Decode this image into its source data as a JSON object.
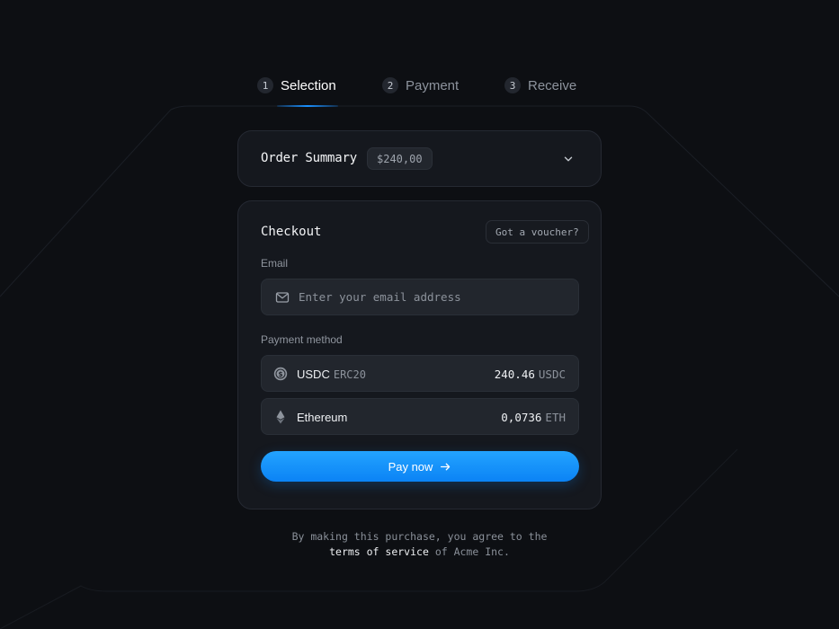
{
  "stepper": {
    "steps": [
      {
        "number": "1",
        "label": "Selection",
        "active": true
      },
      {
        "number": "2",
        "label": "Payment",
        "active": false
      },
      {
        "number": "3",
        "label": "Receive",
        "active": false
      }
    ]
  },
  "order_summary": {
    "title": "Order Summary",
    "amount": "$240,00",
    "toggle_icon": "chevron-down-icon"
  },
  "checkout": {
    "heading": "Checkout",
    "voucher_label": "Got a voucher?",
    "email": {
      "label": "Email",
      "placeholder": "Enter your email address",
      "value": "",
      "icon": "mail-icon"
    },
    "payment_method_label": "Payment method",
    "methods": [
      {
        "name": "USDC",
        "network": "ERC20",
        "amount": "240.46",
        "unit": "USDC",
        "icon": "usdc-icon"
      },
      {
        "name": "Ethereum",
        "network": "",
        "amount": "0,0736",
        "unit": "ETH",
        "icon": "ethereum-icon"
      }
    ],
    "pay_button_label": "Pay now",
    "pay_button_icon": "arrow-right-icon"
  },
  "footer": {
    "line1": "By making this purchase, you agree to the",
    "link_text": "terms of service",
    "line2_suffix": "of Acme Inc."
  },
  "colors": {
    "background": "#0d0f13",
    "card": "#15181e",
    "accent": "#1a90ff"
  }
}
